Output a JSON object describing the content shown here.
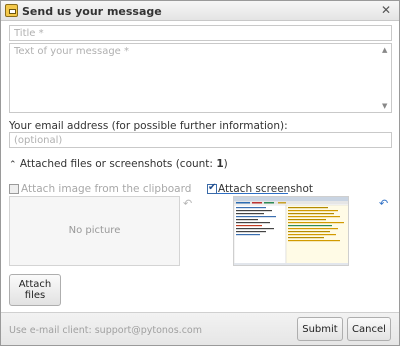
{
  "window": {
    "title": "Send us your message",
    "close_glyph": "✕",
    "app_icon": "app-icon"
  },
  "form": {
    "title_placeholder": "Title *",
    "message_placeholder": "Text of your message *",
    "email_label": "Your email address (for possible further information):",
    "email_placeholder": "(optional)"
  },
  "attachments": {
    "toggle_glyph": "⌃",
    "header_label": "Attached files or screenshots (count: ",
    "count": "1",
    "header_close": ")",
    "clipboard_label": "Attach image from the clipboard",
    "clipboard_checked": false,
    "screenshot_label": "Attach screenshot",
    "screenshot_checked": true,
    "no_picture": "No picture",
    "undo_glyph": "↶",
    "attach_files_label": "Attach files"
  },
  "footer": {
    "email_client_text": "Use e-mail client: support@pytonos.com",
    "submit_label": "Submit",
    "cancel_label": "Cancel"
  },
  "colors": {
    "accent": "#2e6fc5",
    "border": "#c9c9c9"
  }
}
